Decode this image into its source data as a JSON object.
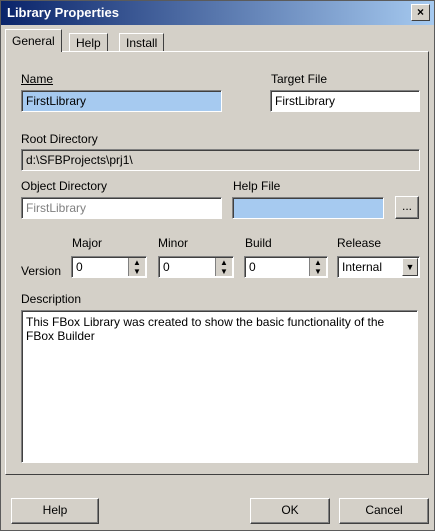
{
  "window": {
    "title": "Library Properties",
    "close_glyph": "×"
  },
  "tabs": [
    {
      "label": "General"
    },
    {
      "label": "Help"
    },
    {
      "label": "Install"
    }
  ],
  "fields": {
    "name": {
      "label": "Name",
      "value": "FirstLibrary"
    },
    "target_file": {
      "label": "Target File",
      "value": "FirstLibrary"
    },
    "root_directory": {
      "label": "Root Directory",
      "value": "d:\\SFBProjects\\prj1\\"
    },
    "object_directory": {
      "label": "Object Directory",
      "value": "FirstLibrary"
    },
    "help_file": {
      "label": "Help File",
      "value": "",
      "browse_label": "..."
    },
    "version": {
      "label": "Version",
      "major": {
        "label": "Major",
        "value": "0"
      },
      "minor": {
        "label": "Minor",
        "value": "0"
      },
      "build": {
        "label": "Build",
        "value": "0"
      },
      "release": {
        "label": "Release",
        "value": "Internal"
      }
    },
    "description": {
      "label": "Description",
      "value": "This FBox Library was created to show the basic functionality of the FBox Builder"
    }
  },
  "buttons": {
    "help": "Help",
    "ok": "OK",
    "cancel": "Cancel"
  }
}
